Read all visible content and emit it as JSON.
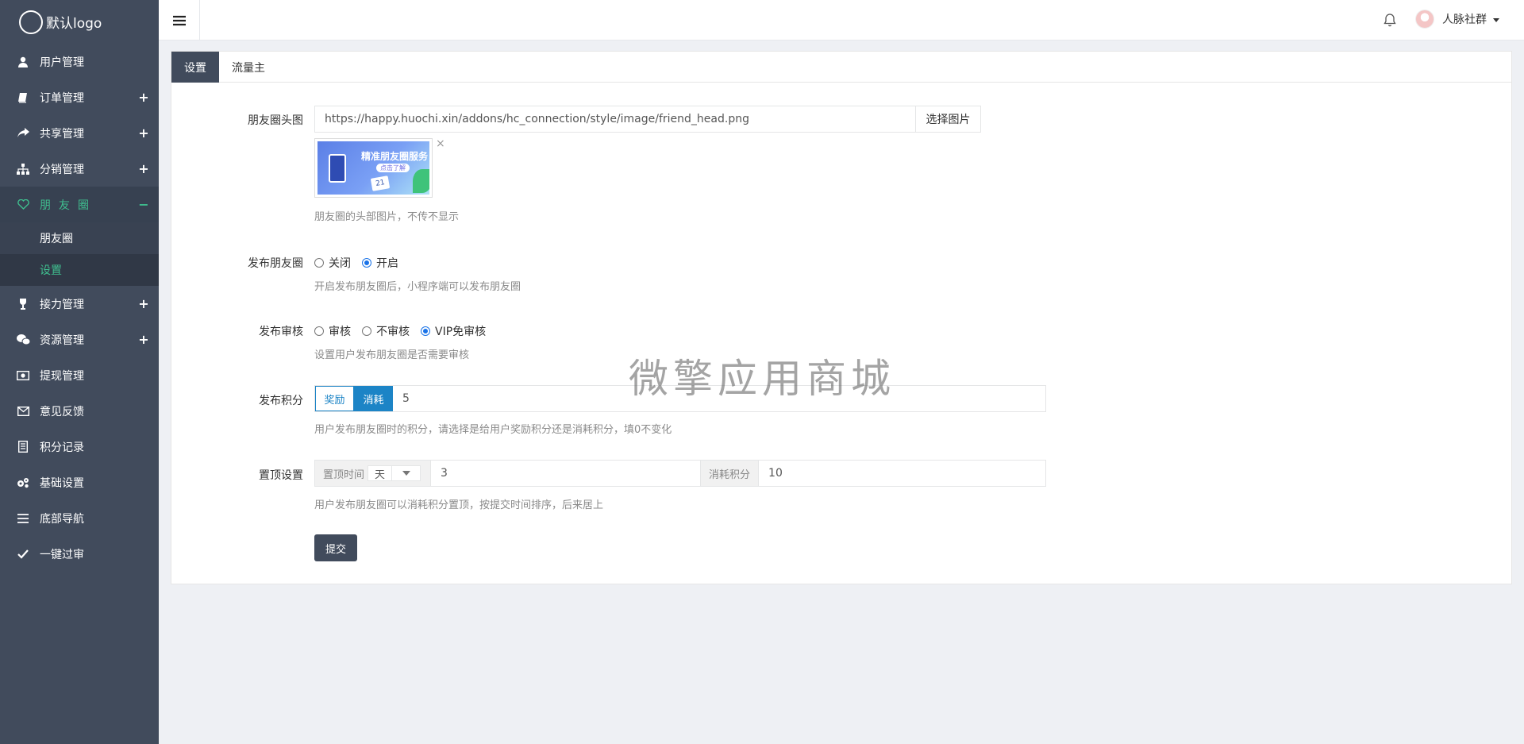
{
  "logo": {
    "text": "默认logo"
  },
  "sidebar": {
    "items": [
      {
        "label": "用户管理",
        "icon": "user-icon",
        "expandable": false
      },
      {
        "label": "订单管理",
        "icon": "book-icon",
        "expandable": true
      },
      {
        "label": "共享管理",
        "icon": "share-icon",
        "expandable": true
      },
      {
        "label": "分销管理",
        "icon": "sitemap-icon",
        "expandable": true
      },
      {
        "label": "朋友圈",
        "icon": "heart-icon",
        "expandable": true,
        "active": true
      },
      {
        "label": "接力管理",
        "icon": "trophy-icon",
        "expandable": true
      },
      {
        "label": "资源管理",
        "icon": "wechat-icon",
        "expandable": true
      },
      {
        "label": "提现管理",
        "icon": "money-icon",
        "expandable": false
      },
      {
        "label": "意见反馈",
        "icon": "envelope-icon",
        "expandable": false
      },
      {
        "label": "积分记录",
        "icon": "list-icon",
        "expandable": false
      },
      {
        "label": "基础设置",
        "icon": "gears-icon",
        "expandable": false
      },
      {
        "label": "底部导航",
        "icon": "bars-icon",
        "expandable": false
      },
      {
        "label": "一键过审",
        "icon": "check-icon",
        "expandable": false
      }
    ],
    "plus": "+",
    "minus": "−",
    "submenu": [
      {
        "label": "朋友圈"
      },
      {
        "label": "设置",
        "current": true
      }
    ]
  },
  "topbar": {
    "user_name": "人脉社群"
  },
  "tabs": [
    {
      "label": "设置",
      "active": true
    },
    {
      "label": "流量主",
      "active": false
    }
  ],
  "form": {
    "head_image": {
      "label": "朋友圈头图",
      "value": "https://happy.huochi.xin/addons/hc_connection/style/image/friend_head.png",
      "button": "选择图片",
      "thumb_title": "精准朋友圈服务",
      "thumb_pill": "点击了解",
      "thumb_number": "21",
      "remove": "×",
      "help": "朋友圈的头部图片，不传不显示"
    },
    "publish": {
      "label": "发布朋友圈",
      "options": [
        {
          "label": "关闭",
          "checked": false
        },
        {
          "label": "开启",
          "checked": true
        }
      ],
      "help": "开启发布朋友圈后，小程序端可以发布朋友圈"
    },
    "review": {
      "label": "发布审核",
      "options": [
        {
          "label": "审核",
          "checked": false
        },
        {
          "label": "不审核",
          "checked": false
        },
        {
          "label": "VIP免审核",
          "checked": true
        }
      ],
      "help": "设置用户发布朋友圈是否需要审核"
    },
    "points": {
      "label": "发布积分",
      "reward": "奖励",
      "consume": "消耗",
      "selected": "消耗",
      "value": "5",
      "help": "用户发布朋友圈时的积分，请选择是给用户奖励积分还是消耗积分，填0不变化"
    },
    "pin": {
      "label": "置顶设置",
      "time_label": "置顶时间",
      "unit": "天",
      "time_value": "3",
      "cost_label": "消耗积分",
      "cost_value": "10",
      "help": "用户发布朋友圈可以消耗积分置顶，按提交时间排序，后来居上"
    },
    "submit": "提交"
  },
  "watermark": "微擎应用商城",
  "colors": {
    "sidebar_bg": "#414b5c",
    "accent_green": "#3fbf8f",
    "primary_blue": "#1c84c6",
    "radio_blue": "#1a73e8"
  }
}
